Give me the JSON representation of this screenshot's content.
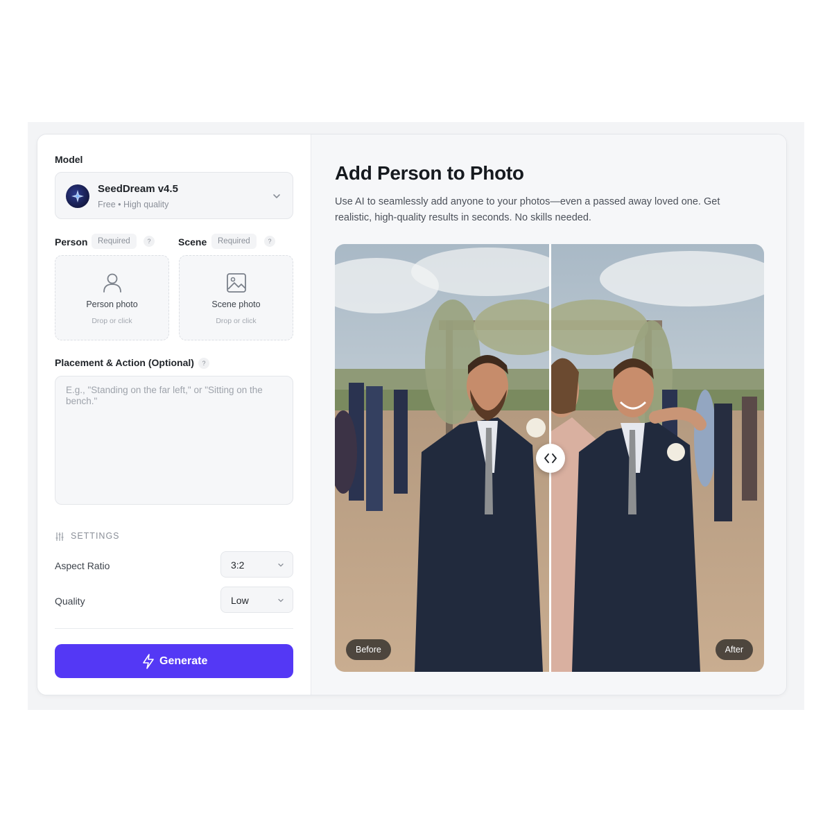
{
  "model": {
    "label": "Model",
    "name": "SeedDream v4.5",
    "meta": "Free • High quality"
  },
  "uploads": {
    "person": {
      "label": "Person",
      "badge": "Required",
      "help": "?",
      "title": "Person photo",
      "hint": "Drop or click"
    },
    "scene": {
      "label": "Scene",
      "badge": "Required",
      "help": "?",
      "title": "Scene photo",
      "hint": "Drop or click"
    }
  },
  "placement": {
    "label": "Placement & Action (Optional)",
    "help": "?",
    "placeholder": "E.g., \"Standing on the far left,\" or \"Sitting on the bench.\""
  },
  "settings": {
    "heading": "SETTINGS",
    "aspect_ratio": {
      "label": "Aspect Ratio",
      "value": "3:2"
    },
    "quality": {
      "label": "Quality",
      "value": "Low"
    }
  },
  "generate_label": "Generate",
  "main": {
    "title": "Add Person to Photo",
    "description": "Use AI to seamlessly add anyone to your photos—even a passed away loved one. Get realistic, high-quality results in seconds. No skills needed.",
    "before_label": "Before",
    "after_label": "After"
  },
  "colors": {
    "accent": "#5438f5",
    "panel_bg": "#f6f7f9"
  }
}
